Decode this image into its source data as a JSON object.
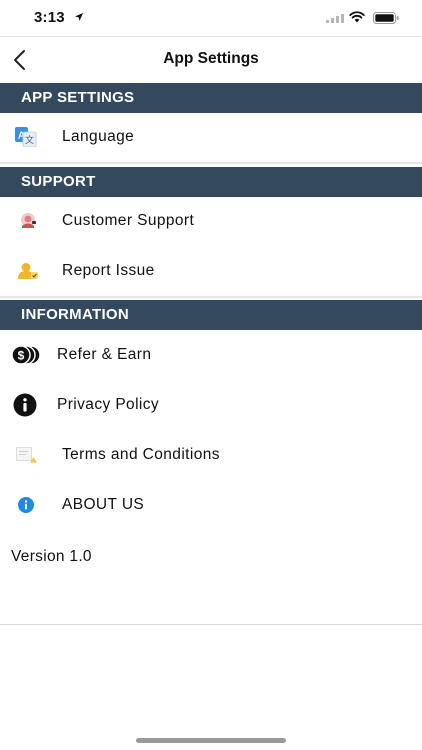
{
  "status_bar": {
    "time": "3:13"
  },
  "nav": {
    "title": "App Settings"
  },
  "sections": {
    "app_settings": {
      "header": "APP SETTINGS",
      "items": [
        {
          "label": "Language",
          "icon": "translate-icon"
        }
      ]
    },
    "support": {
      "header": "SUPPORT",
      "items": [
        {
          "label": "Customer Support",
          "icon": "customer-support-icon"
        },
        {
          "label": "Report Issue",
          "icon": "report-issue-icon"
        }
      ]
    },
    "information": {
      "header": "INFORMATION",
      "items": [
        {
          "label": "Refer & Earn",
          "icon": "coins-icon"
        },
        {
          "label": "Privacy Policy",
          "icon": "info-black-icon"
        },
        {
          "label": "Terms and Conditions",
          "icon": "document-icon"
        },
        {
          "label": "ABOUT US",
          "icon": "info-blue-icon"
        }
      ]
    }
  },
  "footer": {
    "version": "Version 1.0"
  },
  "colors": {
    "section_header_bg": "#34495e",
    "accent_blue": "#1e88e5"
  }
}
